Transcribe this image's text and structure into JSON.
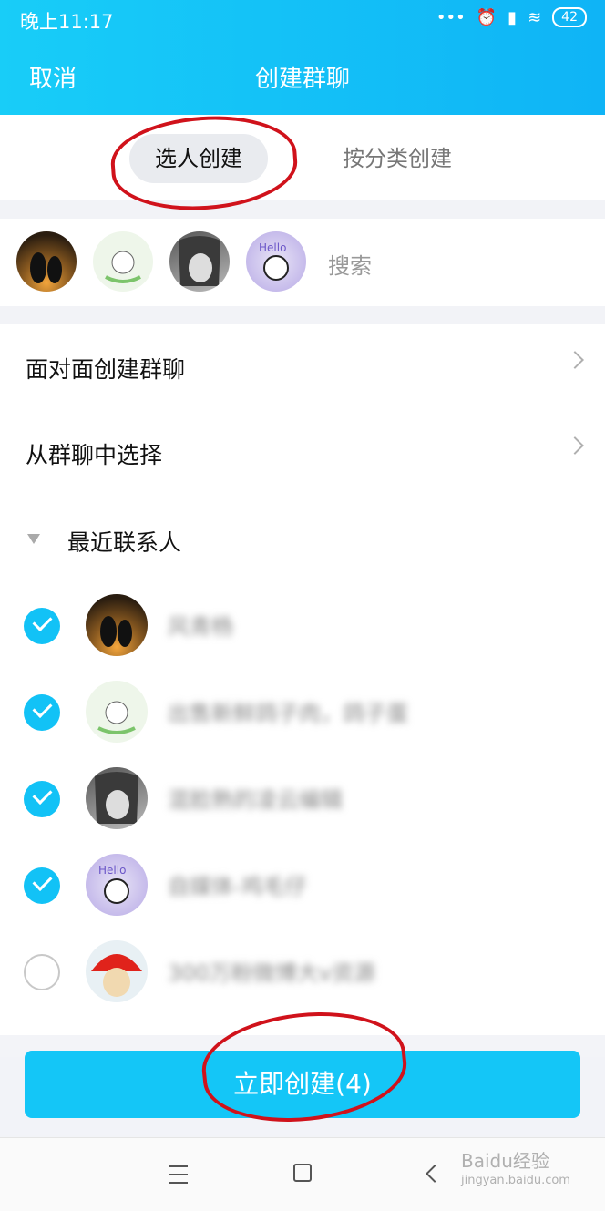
{
  "status": {
    "time": "晚上11:17",
    "battery": "42"
  },
  "header": {
    "cancel": "取消",
    "title": "创建群聊"
  },
  "tabs": [
    {
      "label": "选人创建"
    },
    {
      "label": "按分类创建"
    }
  ],
  "search": {
    "placeholder": "搜索"
  },
  "menu": [
    {
      "label": "面对面创建群聊"
    },
    {
      "label": "从群聊中选择"
    }
  ],
  "section": {
    "label": "最近联系人"
  },
  "contacts": [
    {
      "name": "风青杨",
      "selected": true
    },
    {
      "name": "出售新鲜鸽子肉，鸽子蛋",
      "selected": true
    },
    {
      "name": "混脸熟的凌云编辑",
      "selected": true
    },
    {
      "name": "自媒体-鸡毛仔",
      "selected": true
    },
    {
      "name": "300万粉微博大v资源",
      "selected": false
    }
  ],
  "create_button": {
    "label": "立即创建(4)"
  },
  "watermark": {
    "brand": "Baidu经验",
    "url": "jingyan.baidu.com"
  },
  "colors": {
    "accent": "#14c6f7",
    "annotation": "#d0121b"
  }
}
